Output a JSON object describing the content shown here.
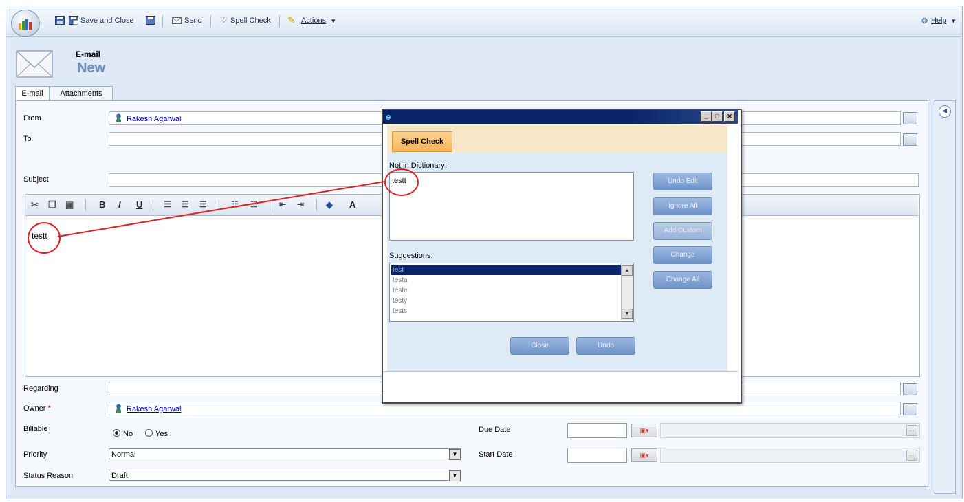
{
  "toolbar": {
    "save_and_close": "Save and Close",
    "send": "Send",
    "spell_check": "Spell Check",
    "actions": "Actions",
    "help": "Help"
  },
  "header": {
    "entity": "E-mail",
    "title": "New"
  },
  "tabs": [
    {
      "label": "E-mail"
    },
    {
      "label": "Attachments"
    }
  ],
  "form": {
    "from_label": "From",
    "from_value": "Rakesh Agarwal",
    "to_label": "To",
    "to_value": "",
    "subject_label": "Subject",
    "subject_value": "",
    "body_text": "testt",
    "regarding_label": "Regarding",
    "regarding_value": "",
    "owner_label": "Owner",
    "owner_required": "*",
    "owner_value": "Rakesh Agarwal",
    "billable_label": "Billable",
    "billable_no": "No",
    "billable_yes": "Yes",
    "billable_selected": "No",
    "priority_label": "Priority",
    "priority_value": "Normal",
    "status_label": "Status Reason",
    "status_value": "Draft",
    "due_date_label": "Due Date",
    "due_date_value": "",
    "start_date_label": "Start Date",
    "start_date_value": ""
  },
  "editor_toolbar": {
    "bold": "B",
    "italic": "I",
    "underline": "U",
    "font_size": "A"
  },
  "dialog": {
    "tab": "Spell Check",
    "not_in_dictionary_label": "Not in Dictionary:",
    "word": "testt",
    "suggestions_label": "Suggestions:",
    "suggestions": [
      "test",
      "testa",
      "teste",
      "testy",
      "tests"
    ],
    "buttons": {
      "undo_edit": "Undo Edit",
      "ignore_all": "Ignore All",
      "add_custom": "Add Custom",
      "change": "Change",
      "change_all": "Change All",
      "close": "Close",
      "undo": "Undo"
    }
  },
  "colors": {
    "accent": "#6a93bf",
    "annotation": "#e02020",
    "dialog_title": "#0a246a",
    "spell_tab": "#f7b659"
  }
}
